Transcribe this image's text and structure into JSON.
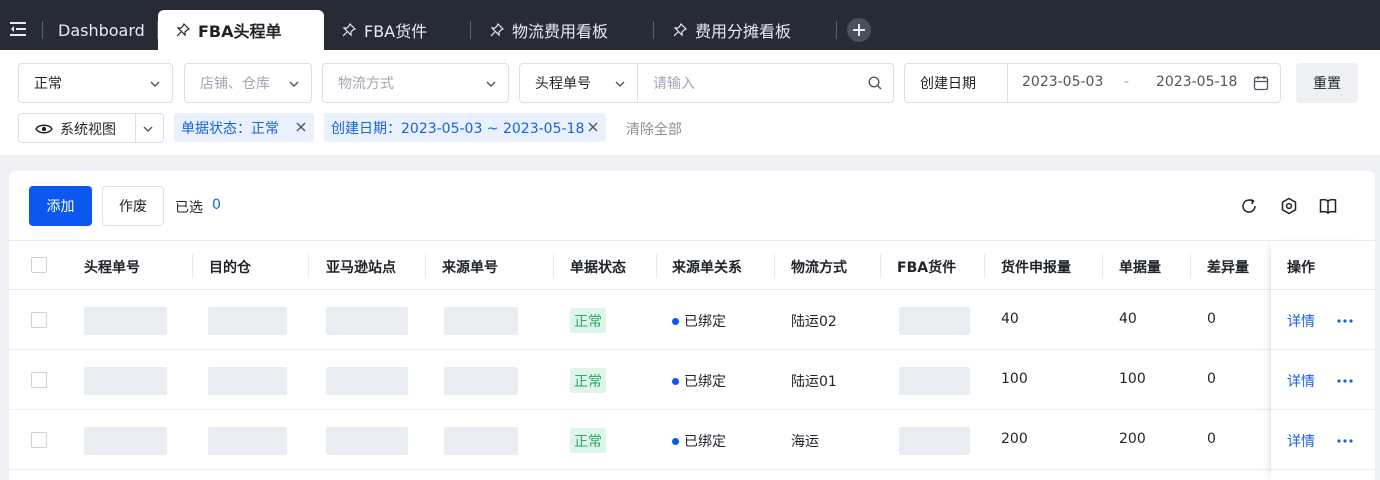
{
  "tabs": [
    {
      "label": "Dashboard",
      "active": false,
      "pinned": false
    },
    {
      "label": "FBA头程单",
      "active": true,
      "pinned": true
    },
    {
      "label": "FBA货件",
      "active": false,
      "pinned": true
    },
    {
      "label": "物流费用看板",
      "active": false,
      "pinned": true
    },
    {
      "label": "费用分摊看板",
      "active": false,
      "pinned": true
    }
  ],
  "filters": {
    "status_select": "正常",
    "store_placeholder": "店铺、仓库",
    "logistics_placeholder": "物流方式",
    "search_field": "头程单号",
    "search_placeholder": "请输入",
    "date_field": "创建日期",
    "date_start": "2023-05-03",
    "date_sep": "-",
    "date_end": "2023-05-18",
    "reset_label": "重置",
    "view_label": "系统视图",
    "chips": [
      {
        "label": "单据状态：正常"
      },
      {
        "label": "创建日期：2023-05-03 ~ 2023-05-18"
      }
    ],
    "clear_all": "清除全部"
  },
  "toolbar": {
    "add_label": "添加",
    "void_label": "作废",
    "selected_label": "已选",
    "selected_count": "0"
  },
  "table": {
    "columns": [
      "头程单号",
      "目的仓",
      "亚马逊站点",
      "来源单号",
      "单据状态",
      "来源单关系",
      "物流方式",
      "FBA货件",
      "货件申报量",
      "单据量",
      "差异量",
      "操作"
    ],
    "rows": [
      {
        "status": "正常",
        "relation": "已绑定",
        "logistics": "陆运02",
        "declared": "40",
        "qty": "40",
        "diff": "0",
        "action": "详情"
      },
      {
        "status": "正常",
        "relation": "已绑定",
        "logistics": "陆运01",
        "declared": "100",
        "qty": "100",
        "diff": "0",
        "action": "详情"
      },
      {
        "status": "正常",
        "relation": "已绑定",
        "logistics": "海运",
        "declared": "200",
        "qty": "200",
        "diff": "0",
        "action": "详情"
      }
    ]
  },
  "colors": {
    "primary": "#0b57f0",
    "tab_bar": "#262b36",
    "status_green": "#2aa868"
  }
}
